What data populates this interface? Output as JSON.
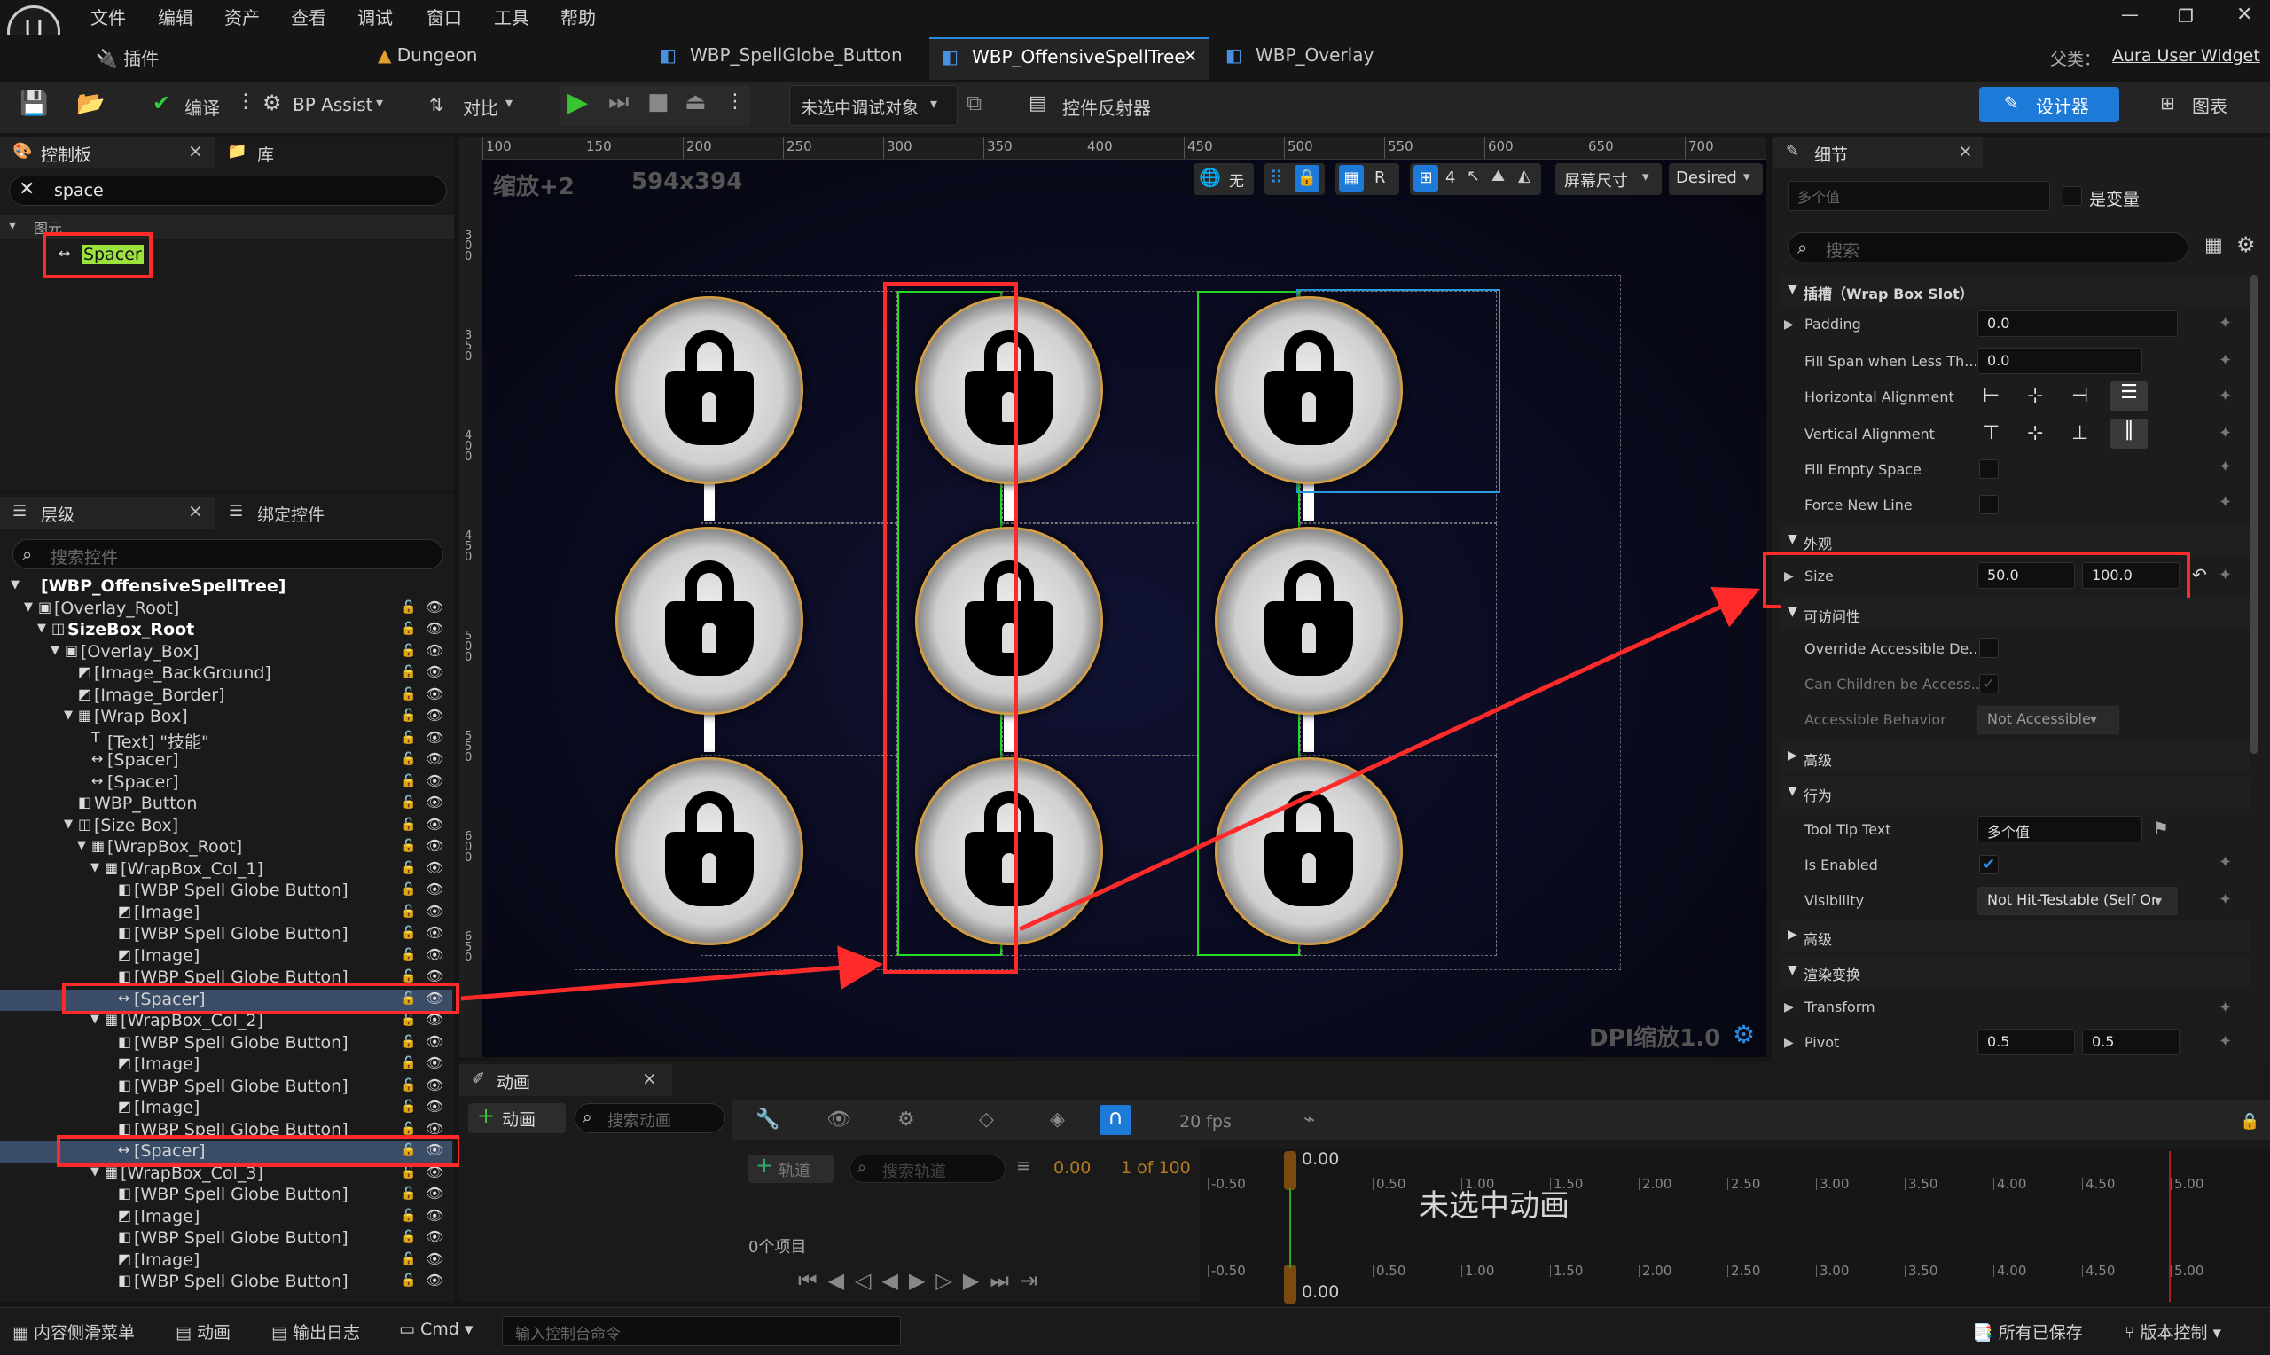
{
  "menu": [
    "文件",
    "编辑",
    "资产",
    "查看",
    "调试",
    "窗口",
    "工具",
    "帮助"
  ],
  "tabs": {
    "plugin": "插件",
    "dungeon": "Dungeon",
    "t1": "WBP_SpellGlobe_Button",
    "t2": "WBP_OffensiveSpellTree",
    "t3": "WBP_Overlay",
    "close": "×"
  },
  "parent": {
    "label": "父类：",
    "value": "Aura User Widget"
  },
  "toolbar": {
    "compile": "编译",
    "bpassist": "BP Assist",
    "diff": "对比",
    "debug": "未选中调试对象",
    "reflector": "控件反射器",
    "designer": "设计器",
    "graph": "图表"
  },
  "palette": {
    "tab": "控制板",
    "lib": "库",
    "search": "space",
    "category": "图元",
    "item": "Spacer"
  },
  "hier": {
    "tab": "层级",
    "bind": "绑定控件",
    "placeholder": "搜索控件",
    "items": [
      "[WBP_OffensiveSpellTree]",
      "[Overlay_Root]",
      "SizeBox_Root",
      "[Overlay_Box]",
      "[Image_BackGround]",
      "[Image_Border]",
      "[Wrap Box]",
      "[Text] \"技能\"",
      "[Spacer]",
      "[Spacer]",
      "WBP_Button",
      "[Size Box]",
      "[WrapBox_Root]",
      "[WrapBox_Col_1]",
      "[WBP Spell Globe Button]",
      "[Image]",
      "[WBP Spell Globe Button]",
      "[Image]",
      "[WBP Spell Globe Button]",
      "[Spacer]",
      "[WrapBox_Col_2]",
      "[WBP Spell Globe Button]",
      "[Image]",
      "[WBP Spell Globe Button]",
      "[Image]",
      "[WBP Spell Globe Button]",
      "[Spacer]",
      "[WrapBox_Col_3]",
      "[WBP Spell Globe Button]",
      "[Image]",
      "[WBP Spell Globe Button]",
      "[Image]",
      "[WBP Spell Globe Button]"
    ]
  },
  "canvas": {
    "zoom": "缩放+2",
    "size": "594x394",
    "none": "无",
    "r": "R",
    "four": "4",
    "screen": "屏幕尺寸",
    "desired": "Desired",
    "dpi": "DPI缩放1.0",
    "ruler_h": [
      "100",
      "150",
      "200",
      "250",
      "300",
      "350",
      "400",
      "450",
      "500",
      "550",
      "600",
      "650",
      "700"
    ],
    "ruler_v": [
      "300",
      "350",
      "400",
      "450",
      "500",
      "550",
      "600",
      "650"
    ]
  },
  "details": {
    "tab": "细节",
    "multi": "多个值",
    "isvar": "是变量",
    "search": "搜索",
    "slot_section": "插槽（Wrap Box Slot）",
    "padding": "Padding",
    "padding_v": "0.0",
    "fillspan": "Fill Span when Less Th...",
    "fillspan_v": "0.0",
    "halign": "Horizontal Alignment",
    "valign": "Vertical Alignment",
    "fillempty": "Fill Empty Space",
    "forcenew": "Force New Line",
    "appearance": "外观",
    "size": "Size",
    "size_x": "50.0",
    "size_y": "100.0",
    "access": "可访问性",
    "override": "Override Accessible De...",
    "canchildren": "Can Children be Access...",
    "accbeh": "Accessible Behavior",
    "accbeh_v": "Not Accessible",
    "advanced1": "高级",
    "behavior": "行为",
    "tooltip": "Tool Tip Text",
    "tooltip_v": "多个值",
    "isenabled": "Is Enabled",
    "visibility": "Visibility",
    "visibility_v": "Not Hit-Testable (Self Or",
    "advanced2": "高级",
    "render": "渲染变换",
    "transform": "Transform",
    "pivot": "Pivot",
    "pivot_x": "0.5",
    "pivot_y": "0.5"
  },
  "anim": {
    "tab": "动画",
    "add": "动画",
    "search": "搜索动画",
    "track": "轨道",
    "track_search": "搜索轨道",
    "time": "0.00",
    "frames": "1 of 100",
    "fps": "20 fps",
    "none": "未选中动画",
    "items": "0个项目",
    "t0": "0.00",
    "t1": "0.00",
    "ticks": [
      "-0.50",
      "0.50",
      "1.00",
      "1.50",
      "2.00",
      "2.50",
      "3.00",
      "3.50",
      "4.00",
      "4.50",
      "5.00"
    ]
  },
  "status": {
    "drawer": "内容侧滑菜单",
    "anim": "动画",
    "log": "输出日志",
    "cmd": "Cmd",
    "cmd_ph": "输入控制台命令",
    "saved": "所有已保存",
    "vc": "版本控制"
  },
  "colors": {
    "accent": "#2a8be0",
    "red": "#ff2a2a",
    "green": "#22dd22",
    "gold": "#b57a1e"
  }
}
